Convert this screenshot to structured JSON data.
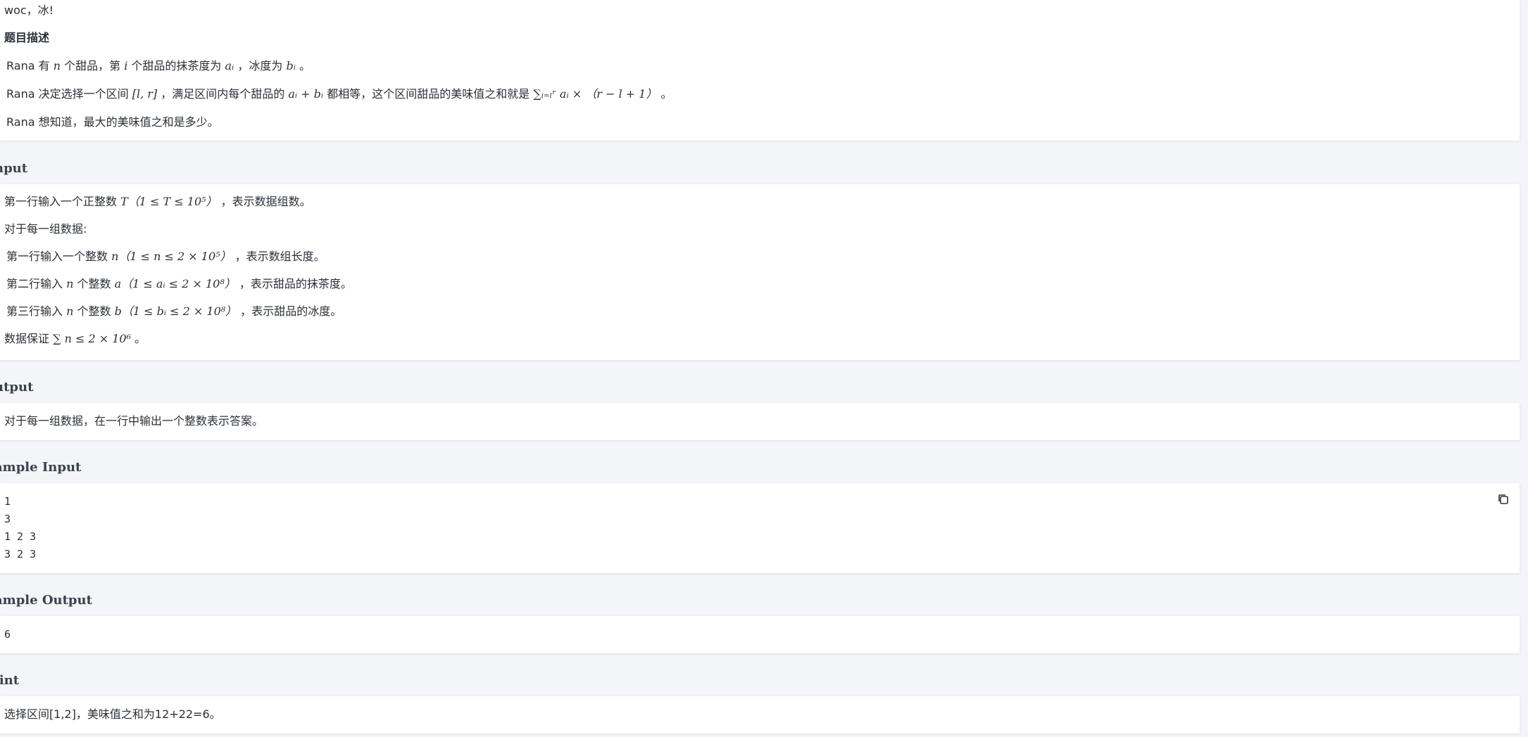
{
  "description": {
    "intro_line": "woc，冰!",
    "heading": "题目描述",
    "line1": {
      "pre": "Rana 有 ",
      "n": "n",
      "mid1": " 个甜品，第 ",
      "i": "i",
      "mid2": " 个甜品的抹茶度为 ",
      "ai": "aᵢ",
      "mid3": " ，冰度为 ",
      "bi": "bᵢ",
      "post": " 。"
    },
    "line2": {
      "pre": "Rana 决定选择一个区间 ",
      "interval": "[l, r]",
      "mid1": " ，满足区间内每个甜品的 ",
      "sum_expr": "aᵢ + bᵢ",
      "mid2": " 都相等，这个区间甜品的美味值之和就是 ",
      "formula": "∑ᵢ₌ₗʳ aᵢ × （r − l + 1）",
      "post": " 。"
    },
    "line3": "Rana 想知道，最大的美味值之和是多少。"
  },
  "input": {
    "heading": "nput",
    "line1": {
      "pre": "第一行输入一个正整数 ",
      "expr": "T（1 ≤ T ≤ 10⁵）",
      "post": " ，表示数据组数。"
    },
    "line2": "对于每一组数据:",
    "line3": {
      "pre": "第一行输入一个整数 ",
      "expr": "n（1 ≤ n ≤ 2 × 10⁵）",
      "post": " ，表示数组长度。"
    },
    "line4": {
      "pre": "第二行输入 ",
      "n": "n",
      "mid": " 个整数 ",
      "expr": "a（1 ≤ aᵢ ≤ 2 × 10⁸）",
      "post": " ，表示甜品的抹茶度。"
    },
    "line5": {
      "pre": "第三行输入 ",
      "n": "n",
      "mid": " 个整数 ",
      "expr": "b（1 ≤ bᵢ ≤ 2 × 10⁸）",
      "post": " ，表示甜品的冰度。"
    },
    "line6": {
      "pre": "数据保证 ",
      "expr": "∑ n ≤ 2 × 10⁶",
      "post": " 。"
    }
  },
  "output": {
    "heading": "utput",
    "line1": "对于每一组数据，在一行中输出一个整数表示答案。"
  },
  "sample_input": {
    "heading": "ample Input",
    "lines": [
      "1",
      "3",
      "1 2 3",
      "3 2 3"
    ],
    "copy_icon": "copy-icon"
  },
  "sample_output": {
    "heading": "ample Output",
    "lines": [
      "6"
    ]
  },
  "hint": {
    "heading": "lint",
    "line1": "选择区间[1,2]，美味值之和为12+22=6。"
  }
}
